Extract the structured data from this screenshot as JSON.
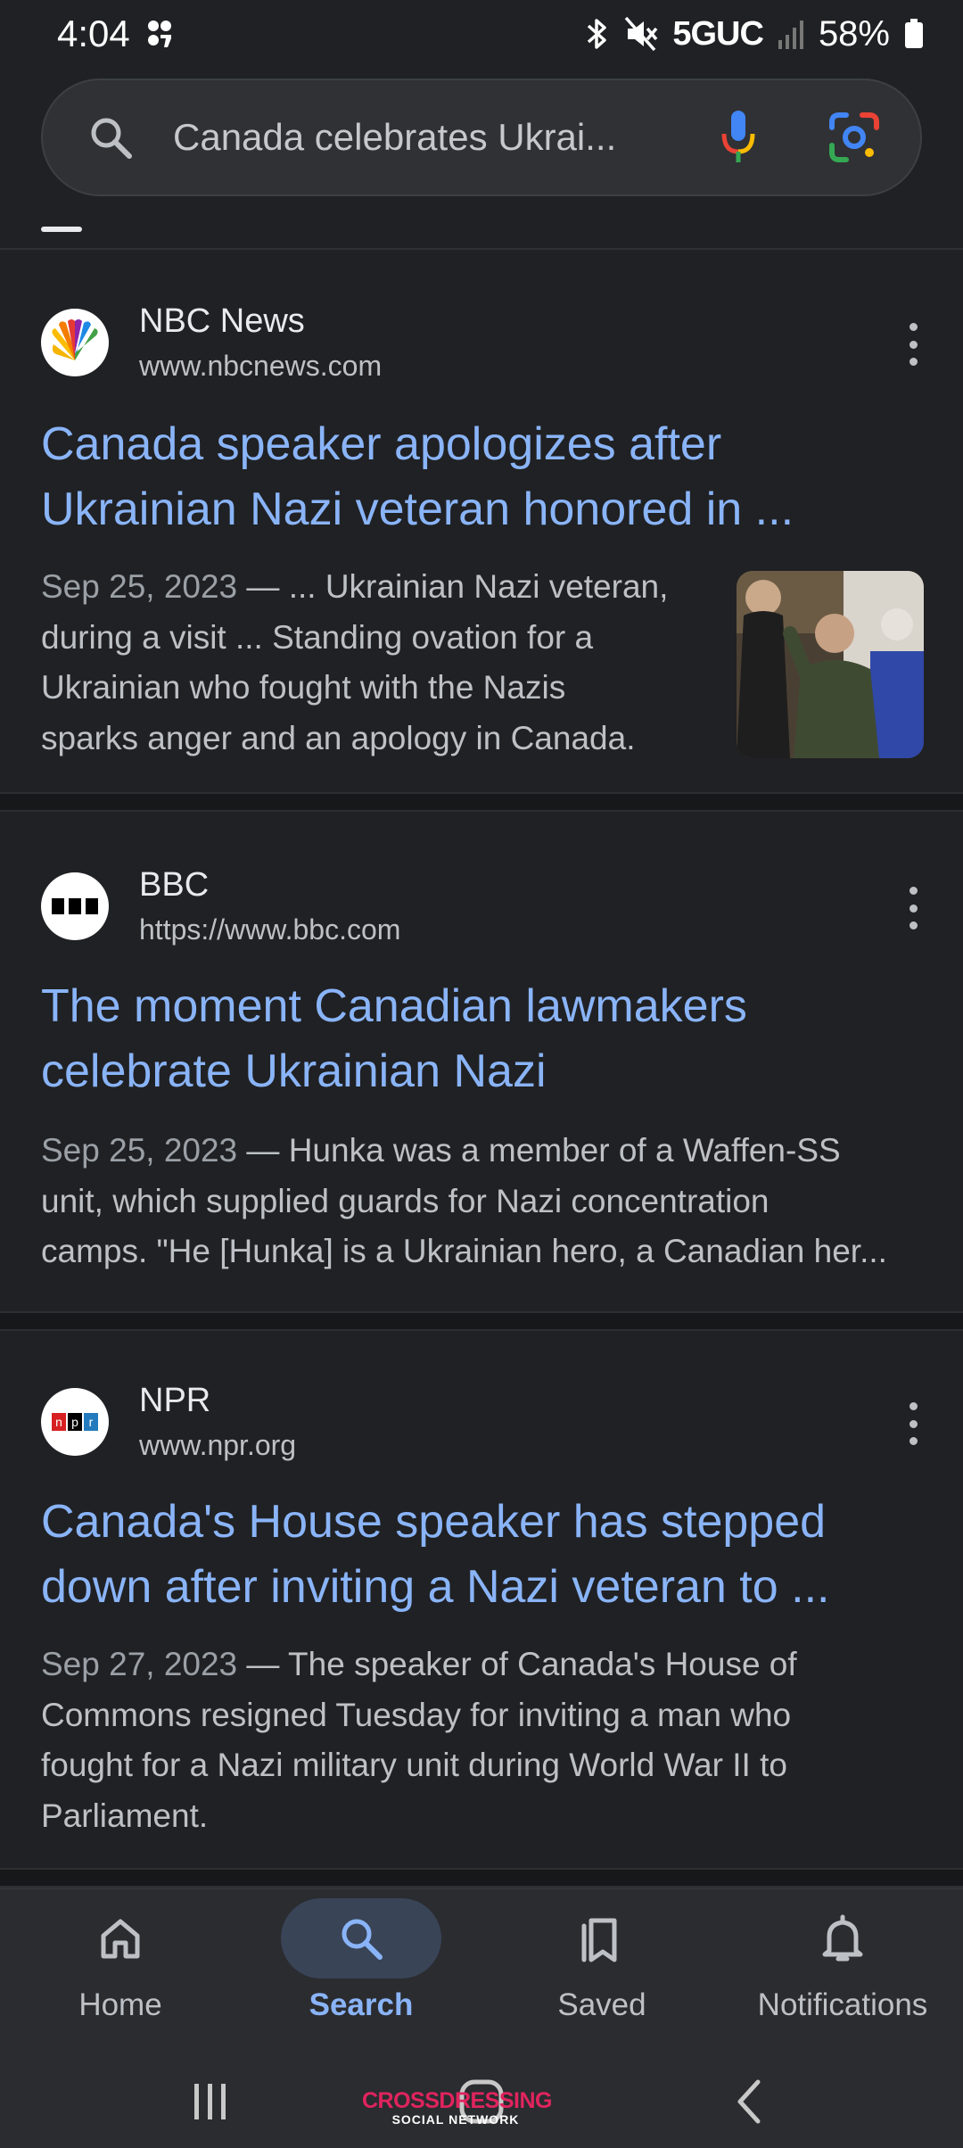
{
  "status_bar": {
    "time": "4:04",
    "network": "5GUC",
    "battery": "58%",
    "icons": [
      "notification-icon",
      "bluetooth-icon",
      "mute-icon",
      "signal-icon",
      "battery-icon"
    ]
  },
  "search": {
    "query": "Canada celebrates Ukrai...",
    "icons": [
      "search-icon",
      "mic-icon",
      "lens-icon"
    ],
    "colors": {
      "background": "#303134",
      "text": "#c6c8cc"
    }
  },
  "results": [
    {
      "source_name": "NBC News",
      "source_url": "www.nbcnews.com",
      "favicon": "nbc-peacock-icon",
      "title_lines": [
        "Canada speaker apologizes after",
        "Ukrainian Nazi veteran honored in ..."
      ],
      "date": "Sep 25, 2023",
      "snippet_lines": [
        " — ... Ukrainian Nazi veteran,",
        "during a visit ... Standing ovation for a",
        "Ukrainian who fought with the Nazis",
        "sparks anger and an apology in Canada."
      ],
      "has_thumbnail": true
    },
    {
      "source_name": "BBC",
      "source_url": "https://www.bbc.com",
      "favicon": "bbc-icon",
      "title_lines": [
        "The moment Canadian lawmakers",
        "celebrate Ukrainian Nazi"
      ],
      "date": "Sep 25, 2023",
      "snippet_lines": [
        " — Hunka was a member of a Waffen-SS",
        "unit, which supplied guards for Nazi concentration",
        "camps. \"He [Hunka] is a Ukrainian hero, a Canadian her..."
      ],
      "has_thumbnail": false
    },
    {
      "source_name": "NPR",
      "source_url": "www.npr.org",
      "favicon": "npr-icon",
      "title_lines": [
        "Canada's House speaker has stepped",
        "down after inviting a Nazi veteran to ..."
      ],
      "date": "Sep 27, 2023",
      "snippet_lines": [
        " — The speaker of Canada's House of",
        "Commons resigned Tuesday for inviting a man who",
        "fought for a Nazi military unit during World War II to",
        "Parliament."
      ],
      "has_thumbnail": false
    }
  ],
  "bottom_nav": [
    {
      "label": "Home",
      "icon": "home-icon",
      "active": false
    },
    {
      "label": "Search",
      "icon": "search-icon",
      "active": true
    },
    {
      "label": "Saved",
      "icon": "bookmark-icon",
      "active": false
    },
    {
      "label": "Notifications",
      "icon": "bell-icon",
      "active": false
    }
  ],
  "system_nav": [
    "recents-icon",
    "home-icon",
    "back-icon"
  ],
  "watermark": {
    "line1": "CROSSDRESSING",
    "line2": "SOCIAL NETWORK"
  },
  "colors": {
    "background": "#202124",
    "link": "#8ab4f8",
    "text_secondary": "#bdc1c6",
    "nav_active_pill": "#394457"
  }
}
